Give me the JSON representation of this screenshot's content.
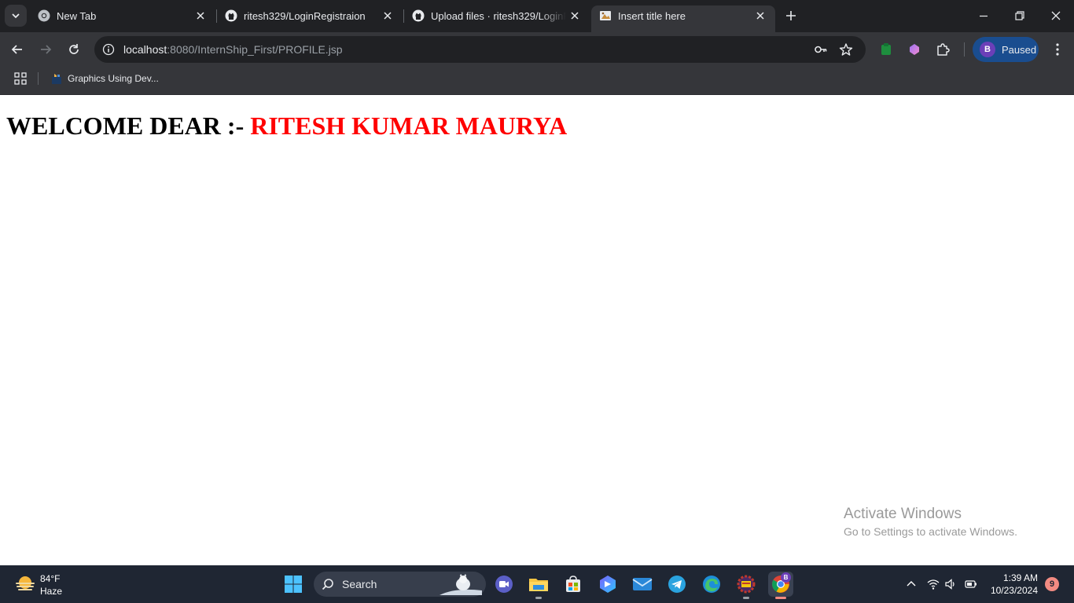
{
  "browser": {
    "tabs": [
      {
        "title": "New Tab",
        "active": false
      },
      {
        "title": "ritesh329/LoginRegistraion",
        "active": false
      },
      {
        "title": "Upload files · ritesh329/LoginRe",
        "active": false
      },
      {
        "title": "Insert title here",
        "active": true
      }
    ],
    "url": {
      "host": "localhost",
      "rest": ":8080/InternShip_First/PROFILE.jsp"
    },
    "profile": {
      "initial": "B",
      "label": "Paused"
    },
    "bookmarks": [
      {
        "label": "Graphics Using Dev..."
      }
    ]
  },
  "page": {
    "welcome_prefix": "WELCOME DEAR :- ",
    "user_name": "RITESH KUMAR MAURYA",
    "name_color": "#ff0000"
  },
  "watermark": {
    "line1": "Activate Windows",
    "line2": "Go to Settings to activate Windows."
  },
  "taskbar": {
    "weather": {
      "temp": "84°F",
      "condition": "Haze"
    },
    "search_label": "Search",
    "clock": {
      "time": "1:39 AM",
      "date": "10/23/2024"
    },
    "notification_count": "9",
    "chrome_badge": "B"
  }
}
